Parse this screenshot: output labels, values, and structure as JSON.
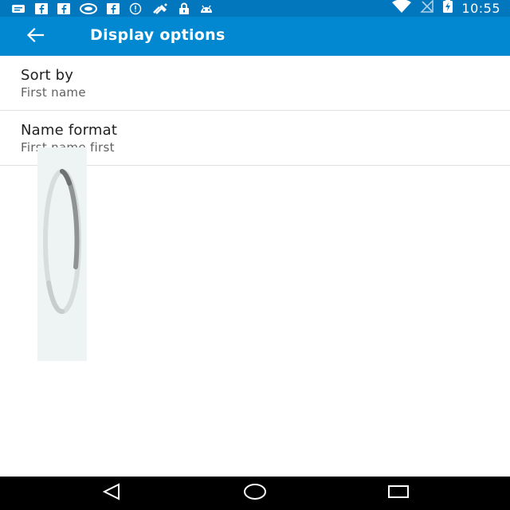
{
  "status_bar": {
    "time": "10:55",
    "background": "#0277bd",
    "left_icons": [
      "notification-icon",
      "facebook-icon",
      "facebook-icon",
      "messaging-icon",
      "facebook-icon",
      "info-icon",
      "satellite-icon",
      "lock-icon",
      "android-icon"
    ],
    "right_icons": [
      "wifi-icon",
      "no-signal-icon",
      "battery-charging-icon"
    ]
  },
  "app_bar": {
    "title": "Display options",
    "background": "#0288d1",
    "back_icon": "arrow-back-icon"
  },
  "settings": [
    {
      "title": "Sort by",
      "summary": "First name"
    },
    {
      "title": "Name format",
      "summary": "First name first"
    }
  ],
  "loading": {
    "icon": "loading-spinner-icon"
  },
  "nav_bar": {
    "background": "#000000",
    "buttons": [
      "back-triangle-icon",
      "home-circle-icon",
      "recents-square-icon"
    ]
  }
}
